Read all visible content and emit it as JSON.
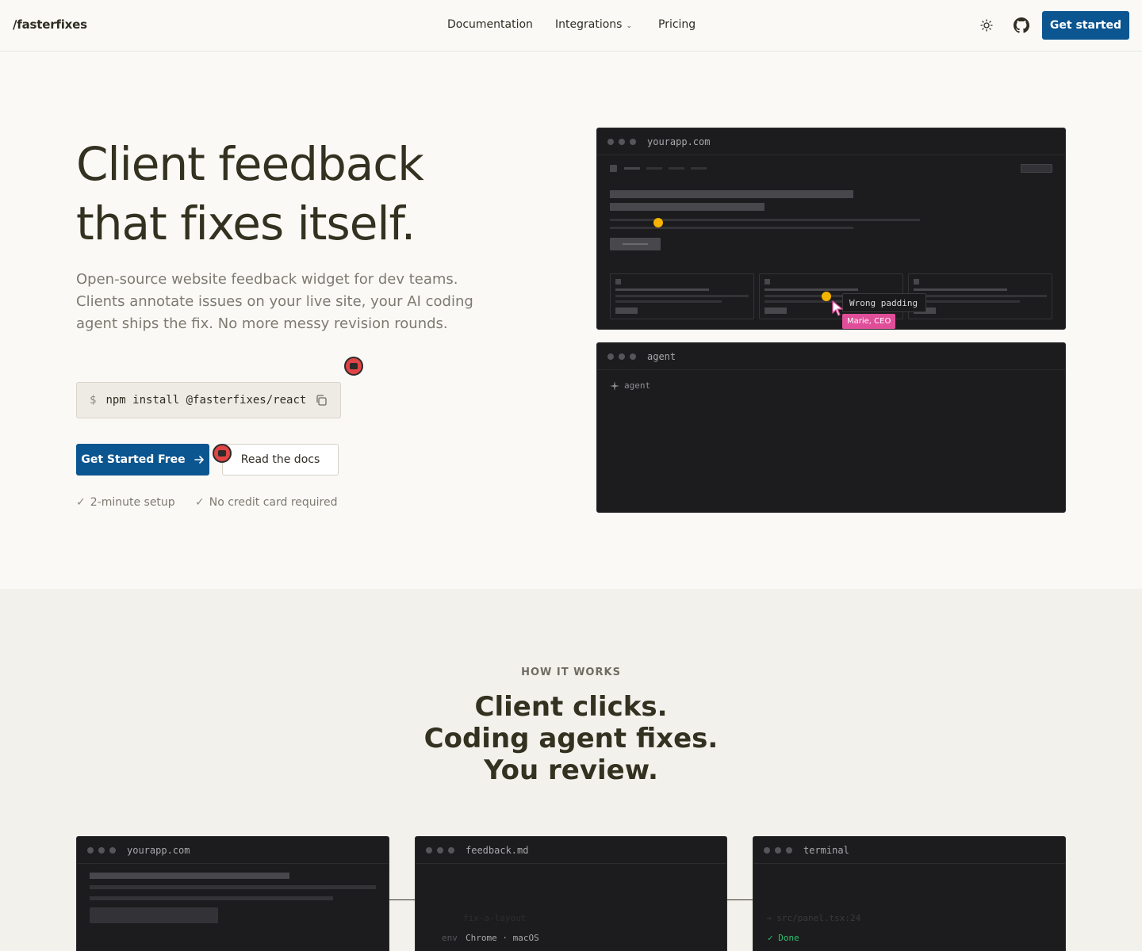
{
  "header": {
    "logo": "/fasterfixes",
    "nav": {
      "documentation": "Documentation",
      "integrations": "Integrations",
      "pricing": "Pricing"
    },
    "cta": "Get started"
  },
  "hero": {
    "title_line1": "Client feedback",
    "title_line2": "that fixes itself.",
    "subtitle": "Open-source website feedback widget for dev teams. Clients annotate issues on your live site, your AI coding agent ships the fix. No more messy revision rounds.",
    "install_prompt": "$",
    "install_command": "npm install @fasterfixes/react",
    "primary_button": "Get Started Free",
    "secondary_button": "Read the docs",
    "checks": [
      "2-minute setup",
      "No credit card required"
    ]
  },
  "preview": {
    "browser_title": "yourapp.com",
    "annotation_text": "Wrong padding",
    "annotation_author": "Marie, CEO",
    "agent_title": "agent",
    "agent_label": "agent"
  },
  "how": {
    "eyebrow": "HOW IT WORKS",
    "headline_1": "Client clicks.",
    "headline_2": "Coding agent fixes.",
    "headline_3": "You review.",
    "windows": [
      {
        "title": "yourapp.com"
      },
      {
        "title": "feedback.md",
        "faded_line": "fix-a-layout",
        "env_label": "env",
        "env_value": "Chrome · macOS"
      },
      {
        "title": "terminal",
        "faded_line": "src/panel.tsx:24",
        "done_label": "Done"
      }
    ]
  },
  "colors": {
    "accent": "#0b5590",
    "pin": "#e04444",
    "marker": "#f5b400",
    "author_tag": "#e04e9a",
    "success": "#2fbf71"
  }
}
